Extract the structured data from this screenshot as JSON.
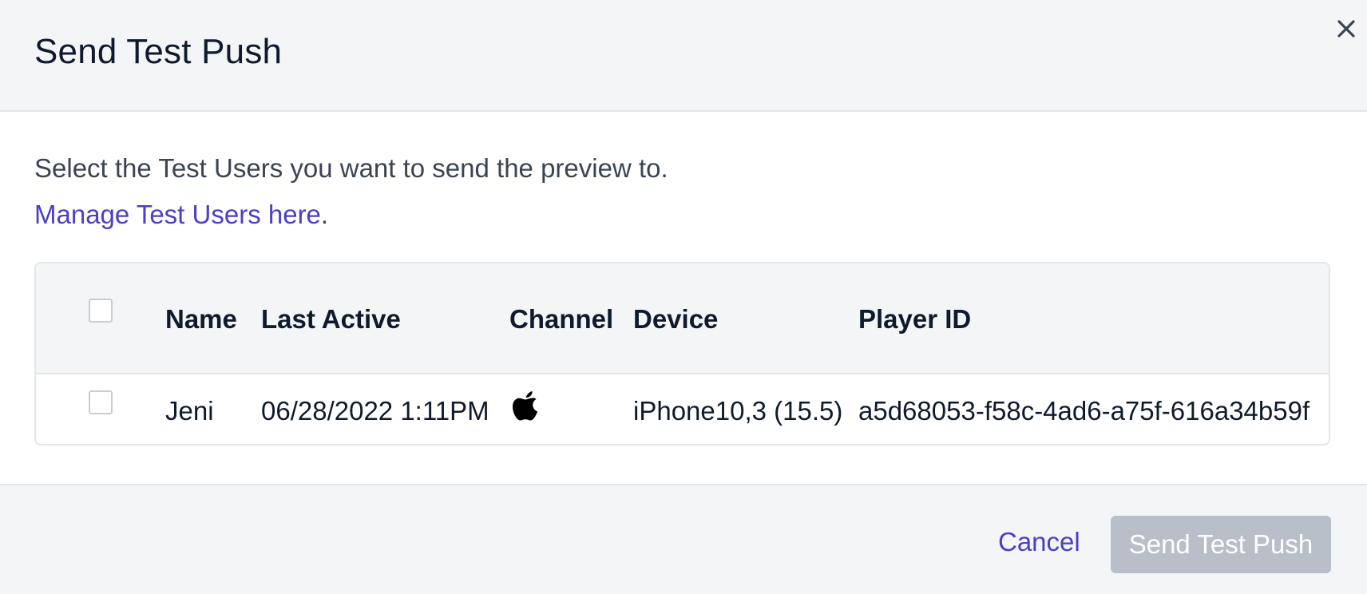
{
  "modal": {
    "title": "Send Test Push",
    "close_icon": "close-icon"
  },
  "body": {
    "intro_text": "Select the Test Users you want to send the preview to.",
    "manage_link_text": "Manage Test Users here",
    "manage_suffix": "."
  },
  "table": {
    "headers": {
      "name": "Name",
      "last_active": "Last Active",
      "channel": "Channel",
      "device": "Device",
      "player_id": "Player ID"
    },
    "rows": [
      {
        "name": "Jeni",
        "last_active": "06/28/2022 1:11PM",
        "channel_icon": "apple-icon",
        "device": "iPhone10,3 (15.5)",
        "player_id": "a5d68053-f58c-4ad6-a75f-616a34b59f"
      }
    ]
  },
  "footer": {
    "cancel_label": "Cancel",
    "send_label": "Send Test Push"
  },
  "colors": {
    "accent": "#4a3fc8",
    "header_bg": "#f4f5f7",
    "disabled_button": "#b9bfc8"
  }
}
